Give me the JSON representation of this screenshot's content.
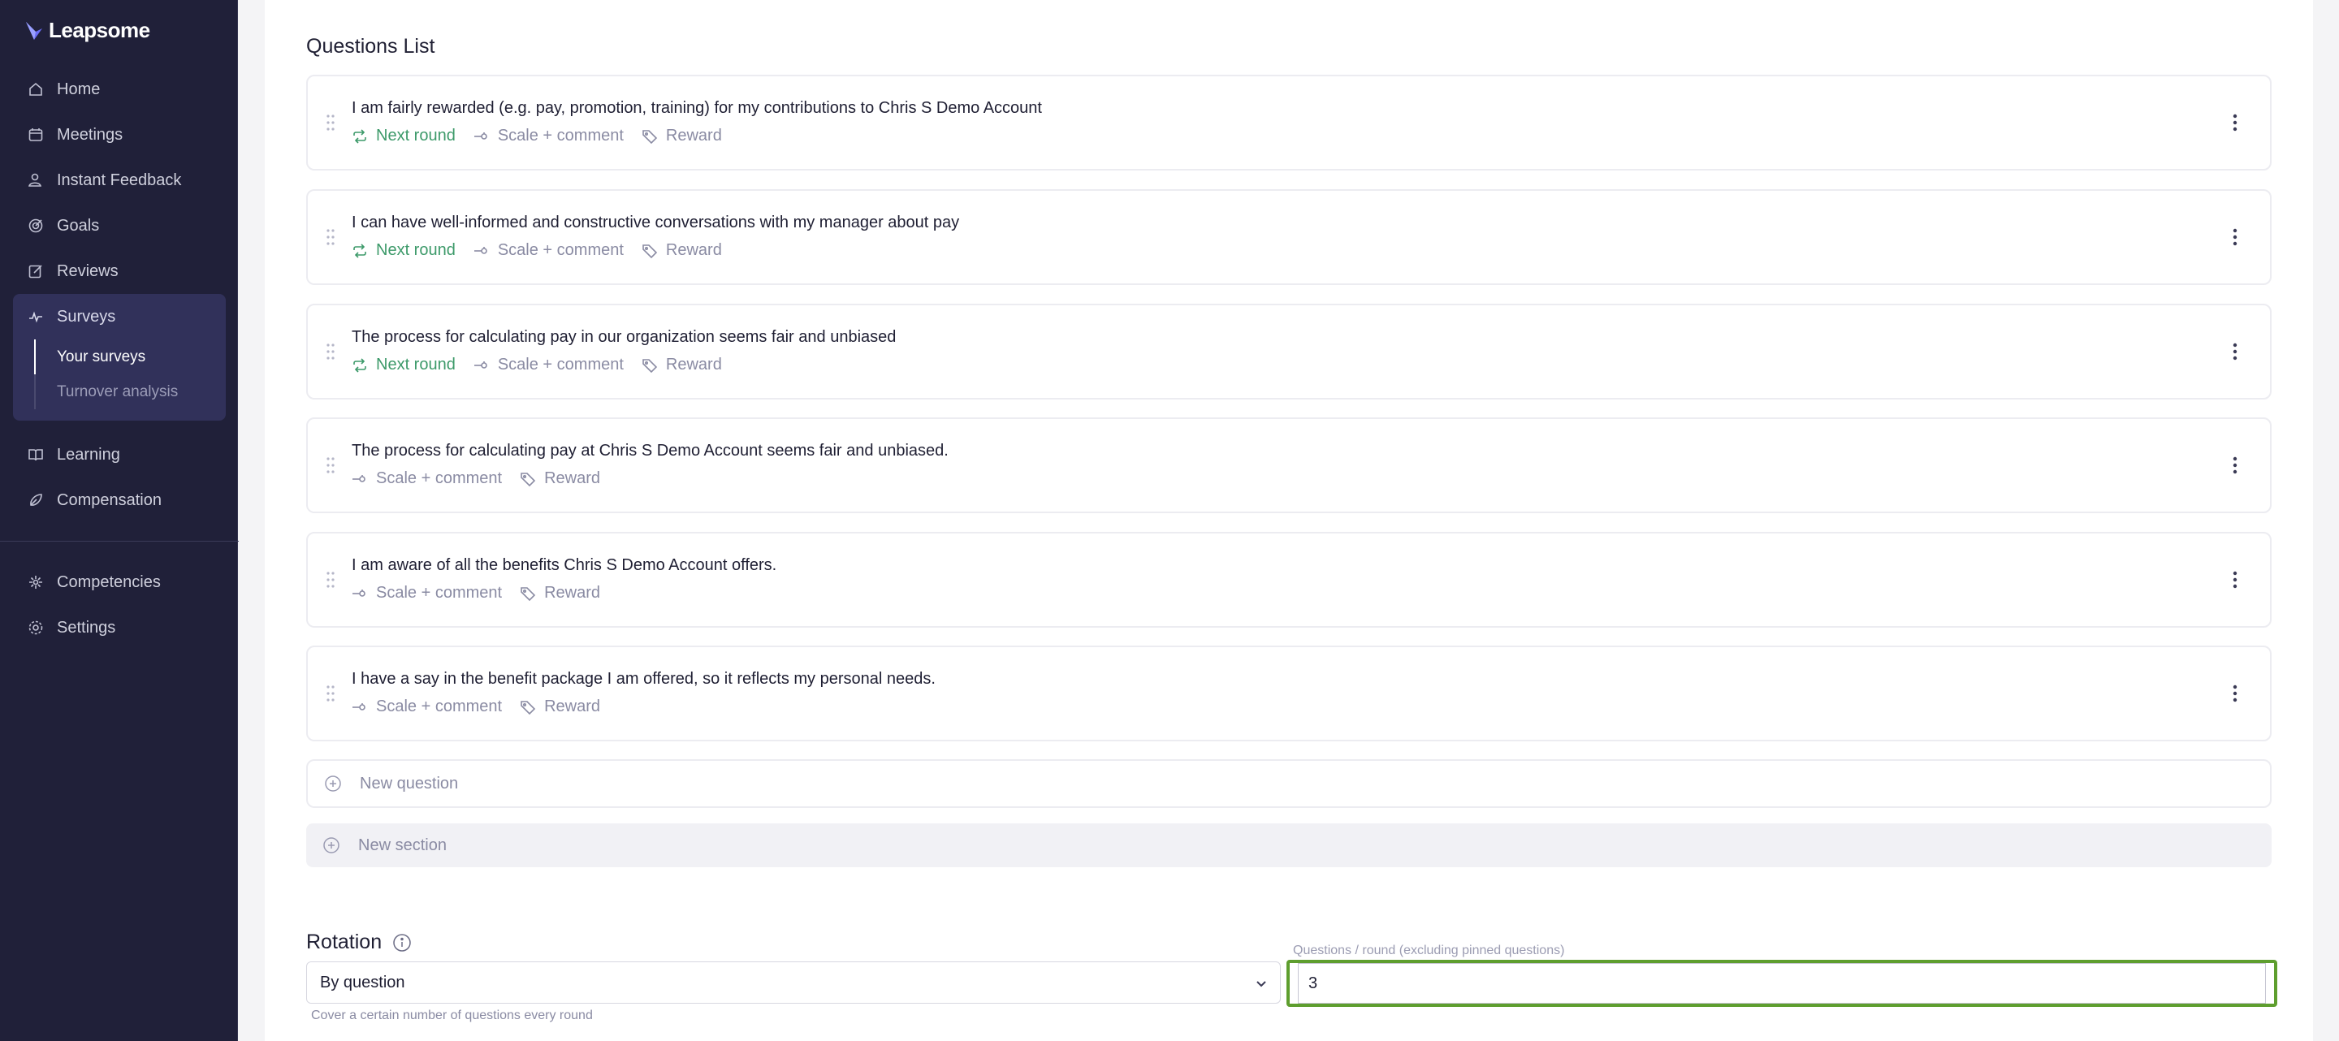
{
  "brand": {
    "name": "Leapsome"
  },
  "sidebar": {
    "items": [
      {
        "label": "Home",
        "icon": "home-icon"
      },
      {
        "label": "Meetings",
        "icon": "meetings-icon"
      },
      {
        "label": "Instant Feedback",
        "icon": "feedback-icon"
      },
      {
        "label": "Goals",
        "icon": "goals-icon"
      },
      {
        "label": "Reviews",
        "icon": "reviews-icon"
      }
    ],
    "surveys": {
      "label": "Surveys",
      "icon": "surveys-icon",
      "subitems": [
        {
          "label": "Your surveys",
          "current": true
        },
        {
          "label": "Turnover analysis",
          "current": false
        }
      ]
    },
    "items2": [
      {
        "label": "Learning",
        "icon": "learning-icon"
      },
      {
        "label": "Compensation",
        "icon": "compensation-icon"
      }
    ],
    "items3": [
      {
        "label": "Competencies",
        "icon": "competencies-icon"
      },
      {
        "label": "Settings",
        "icon": "settings-icon"
      }
    ]
  },
  "questions_list": {
    "title": "Questions List",
    "labels": {
      "next_round": "Next round",
      "scale_comment": "Scale + comment",
      "reward": "Reward"
    },
    "questions": [
      {
        "text": "I am fairly rewarded (e.g. pay, promotion, training) for my contributions to Chris S Demo Account",
        "next_round": true
      },
      {
        "text": "I can have well-informed and constructive conversations with my manager about pay",
        "next_round": true
      },
      {
        "text": "The process for calculating pay in our organization seems fair and unbiased",
        "next_round": true
      },
      {
        "text": "The process for calculating pay at Chris S Demo Account seems fair and unbiased.",
        "next_round": false
      },
      {
        "text": "I am aware of all the benefits Chris S Demo Account offers.",
        "next_round": false
      },
      {
        "text": "I have a say in the benefit package I am offered, so it reflects my personal needs.",
        "next_round": false
      }
    ],
    "new_question": "New question",
    "new_section": "New section"
  },
  "rotation": {
    "title": "Rotation",
    "select_value": "By question",
    "select_help": "Cover a certain number of questions every round",
    "field_label": "Questions / round (excluding pinned questions)",
    "field_value": "3"
  },
  "colors": {
    "sidebar_bg": "#202039",
    "active_bg": "#31315a",
    "green": "#3d9a6a",
    "focus_border": "#5e9e2e"
  }
}
